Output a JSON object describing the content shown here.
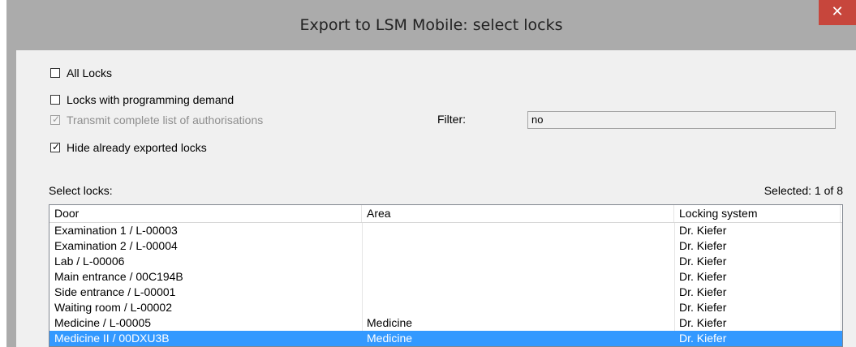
{
  "window": {
    "title": "Export to LSM Mobile: select locks",
    "close_glyph": "✕"
  },
  "options": {
    "all_locks": {
      "label": "All Locks",
      "checked": false
    },
    "programming_demand": {
      "label": "Locks with programming demand",
      "checked": false
    },
    "transmit_authorisations": {
      "label": "Transmit complete list of authorisations",
      "checked": true,
      "disabled": true
    },
    "hide_exported": {
      "label": "Hide already exported locks",
      "checked": true
    }
  },
  "check_glyph": "✓",
  "filter": {
    "label": "Filter:",
    "value": "no"
  },
  "list": {
    "label": "Select locks:",
    "selected_count": "Selected: 1 of 8",
    "columns": [
      "Door",
      "Area",
      "Locking system"
    ],
    "rows": [
      {
        "door": "Examination 1 / L-00003",
        "area": "",
        "system": "Dr. Kiefer"
      },
      {
        "door": "Examination 2 / L-00004",
        "area": "",
        "system": "Dr. Kiefer"
      },
      {
        "door": "Lab / L-00006",
        "area": "",
        "system": "Dr. Kiefer"
      },
      {
        "door": "Main entrance / 00C194B",
        "area": "",
        "system": "Dr. Kiefer"
      },
      {
        "door": "Side entrance / L-00001",
        "area": "",
        "system": "Dr. Kiefer"
      },
      {
        "door": "Waiting room / L-00002",
        "area": "",
        "system": "Dr. Kiefer"
      },
      {
        "door": "Medicine / L-00005",
        "area": "Medicine",
        "system": "Dr. Kiefer"
      },
      {
        "door": "Medicine II / 00DXU3B",
        "area": "Medicine",
        "system": "Dr. Kiefer",
        "selected": true
      }
    ]
  },
  "colors": {
    "titlebar": "#ababab",
    "close_button": "#c7463c",
    "selection": "#3399ff"
  }
}
